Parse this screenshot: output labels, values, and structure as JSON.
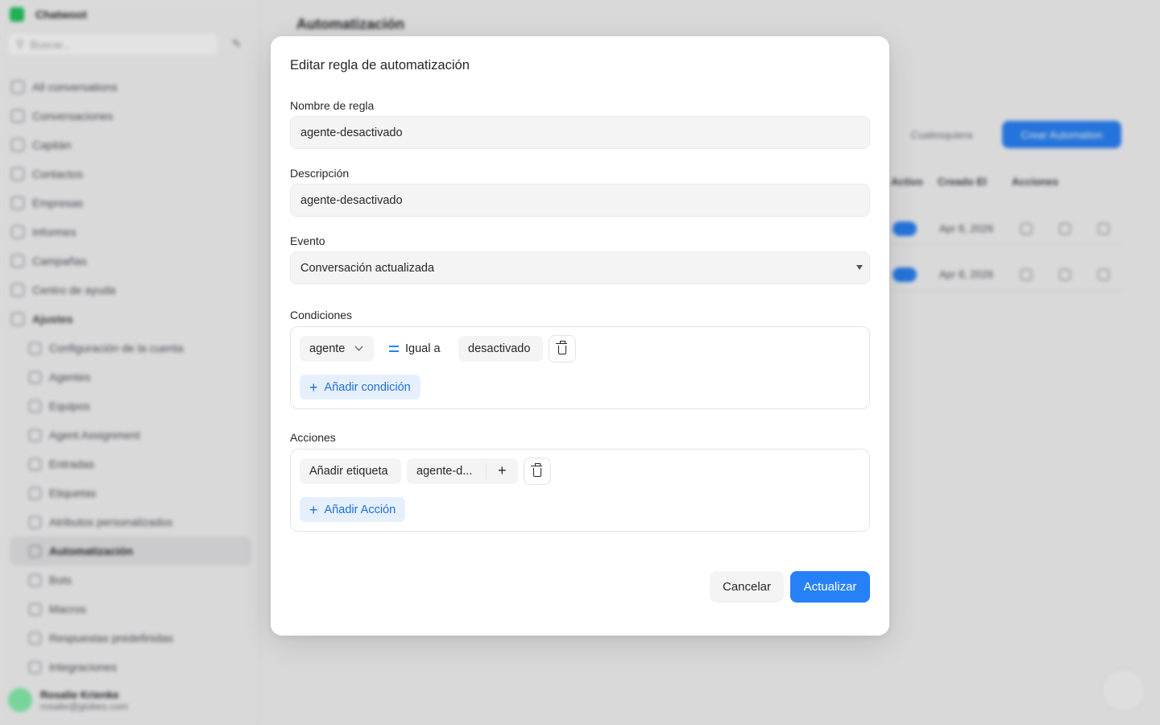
{
  "app": {
    "brand": "Chatwoot",
    "search_placeholder": "Buscar...",
    "page_title": "Automatización",
    "nav": [
      "All conversations",
      "Conversaciones",
      "Capitán",
      "Contactos",
      "Empresas",
      "Informes",
      "Campañas",
      "Centro de ayuda"
    ],
    "settings_group": "Ajustes",
    "settings_items": [
      "Configuración de la cuenta",
      "Agentes",
      "Equipos",
      "Agent Assignment",
      "Entradas",
      "Etiquetas",
      "Atributos personalizados",
      "Automatización",
      "Bots",
      "Macros",
      "Respuestas predefinidas",
      "Integraciones"
    ],
    "user": {
      "name": "Rosalie Krienke",
      "email": "rosalie@globex.com"
    },
    "header_buttons": {
      "secondary": "Cualesquiera",
      "primary": "Crear Automation"
    },
    "table_headers": [
      "Activo",
      "Creado El",
      "Acciones"
    ],
    "rows": [
      {
        "date": "Apr 8, 2026"
      },
      {
        "date": "Apr 8, 2026"
      }
    ]
  },
  "modal": {
    "title": "Editar regla de automatización",
    "rule_name": {
      "label": "Nombre de regla",
      "value": "agente-desactivado"
    },
    "description": {
      "label": "Descripción",
      "value": "agente-desactivado"
    },
    "event": {
      "label": "Evento",
      "value": "Conversación actualizada"
    },
    "conditions": {
      "label": "Condiciones",
      "attribute": "agente",
      "operator": "Igual a",
      "value": "desactivado",
      "add_label": "Añadir condición"
    },
    "actions": {
      "label": "Acciones",
      "action": "Añadir etiqueta",
      "tag": "agente-d...",
      "add_label": "Añadir Acción"
    },
    "cancel_label": "Cancelar",
    "submit_label": "Actualizar"
  },
  "colors": {
    "accent": "#2781f6",
    "accent_soft": "#e6f0fd"
  }
}
